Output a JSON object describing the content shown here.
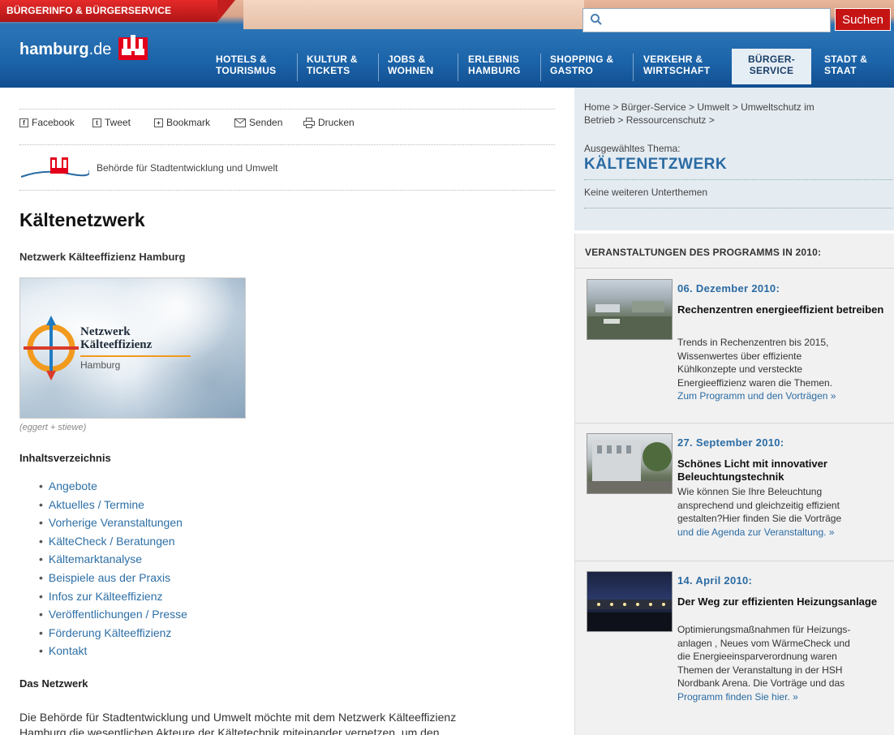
{
  "header": {
    "top_tag": "BÜRGERINFO & BÜRGERSERVICE",
    "logo_name": "hamburg",
    "logo_tld": ".de",
    "search_placeholder": "",
    "search_button": "Suchen",
    "nav": [
      {
        "line1": "HOTELS &",
        "line2": "TOURISMUS"
      },
      {
        "line1": "KULTUR &",
        "line2": "TICKETS"
      },
      {
        "line1": "JOBS &",
        "line2": "WOHNEN"
      },
      {
        "line1": "ERLEBNIS",
        "line2": "HAMBURG"
      },
      {
        "line1": "SHOPPING &",
        "line2": "GASTRO"
      },
      {
        "line1": "VERKEHR &",
        "line2": "WIRTSCHAFT"
      },
      {
        "line1": "BÜRGER-",
        "line2": "SERVICE"
      },
      {
        "line1": "STADT &",
        "line2": "STAAT"
      }
    ],
    "active_nav_index": 6
  },
  "share": {
    "facebook": "Facebook",
    "tweet": "Tweet",
    "bookmark": "Bookmark",
    "senden": "Senden",
    "drucken": "Drucken"
  },
  "authority": "Behörde für Stadtentwicklung und Umwelt",
  "main": {
    "title": "Kältenetzwerk",
    "subtitle": "Netzwerk Kälteeffizienz Hamburg",
    "hero_title_line1": "Netzwerk",
    "hero_title_line2": "Kälteeffizienz",
    "hero_city": "Hamburg",
    "caption": "(eggert + stiewe)",
    "toc_title": "Inhaltsverzeichnis",
    "toc": [
      "Angebote",
      "Aktuelles / Termine",
      "Vorherige Veranstaltungen",
      "KälteCheck / Beratungen",
      "Kältemarktanalyse",
      "Beispiele aus der Praxis",
      "Infos zur Kälteeffizienz",
      "Veröffentlichungen / Presse",
      "Förderung Kälteeffizienz",
      "Kontakt"
    ],
    "section_title": "Das Netzwerk",
    "intro_line1": "Die Behörde für Stadtentwicklung und Umwelt möchte mit dem Netzwerk Kälteeffizienz",
    "intro_line2": "Hamburg die wesentlichen Akteure der Kältetechnik miteinander vernetzen, um den"
  },
  "sidebar": {
    "breadcrumb_line1": "Home > Bürger-Service > Umwelt > Umweltschutz im",
    "breadcrumb_line2": "Betrieb > Ressourcenschutz >",
    "theme_label": "Ausgewähltes Thema:",
    "theme_name": "KÄLTENETZWERK",
    "subtopics": "Keine weiteren Unterthemen",
    "events_title": "VERANSTALTUNGEN DES PROGRAMMS IN 2010:",
    "events": [
      {
        "date": "06. Dezember 2010:",
        "headline": "Rechenzentren energieeffizient betreiben",
        "desc": [
          "Trends in Rechenzentren bis 2015,",
          "Wissenwertes über effiziente",
          "Kühlkonzepte und versteckte",
          "Energieeffizienz waren die Themen."
        ],
        "more": "Zum Programm und den Vorträgen »"
      },
      {
        "date": "27. September 2010:",
        "headline": "Schönes Licht mit innovativer Beleuchtungstechnik",
        "desc": [
          "Wie können Sie Ihre Beleuchtung",
          "ansprechend und gleichzeitig effizient",
          "gestalten?Hier finden Sie die Vorträge"
        ],
        "more": "und die Agenda zur Veranstaltung. »"
      },
      {
        "date": "14. April 2010:",
        "headline": "Der Weg zur effizienten Heizungsanlage",
        "desc": [
          "Optimierungsmaßnahmen für Heizungs-",
          "anlagen , Neues vom WärmeCheck und",
          "die Energieeinsparverordnung waren",
          "Themen der Veranstaltung in der HSH",
          "Nordbank Arena.  Die Vorträge und das"
        ],
        "more": "Programm finden Sie hier. »"
      }
    ]
  },
  "colors": {
    "brand_red": "#c51414",
    "brand_blue": "#1c64a9",
    "link_blue": "#2a6ba3"
  }
}
